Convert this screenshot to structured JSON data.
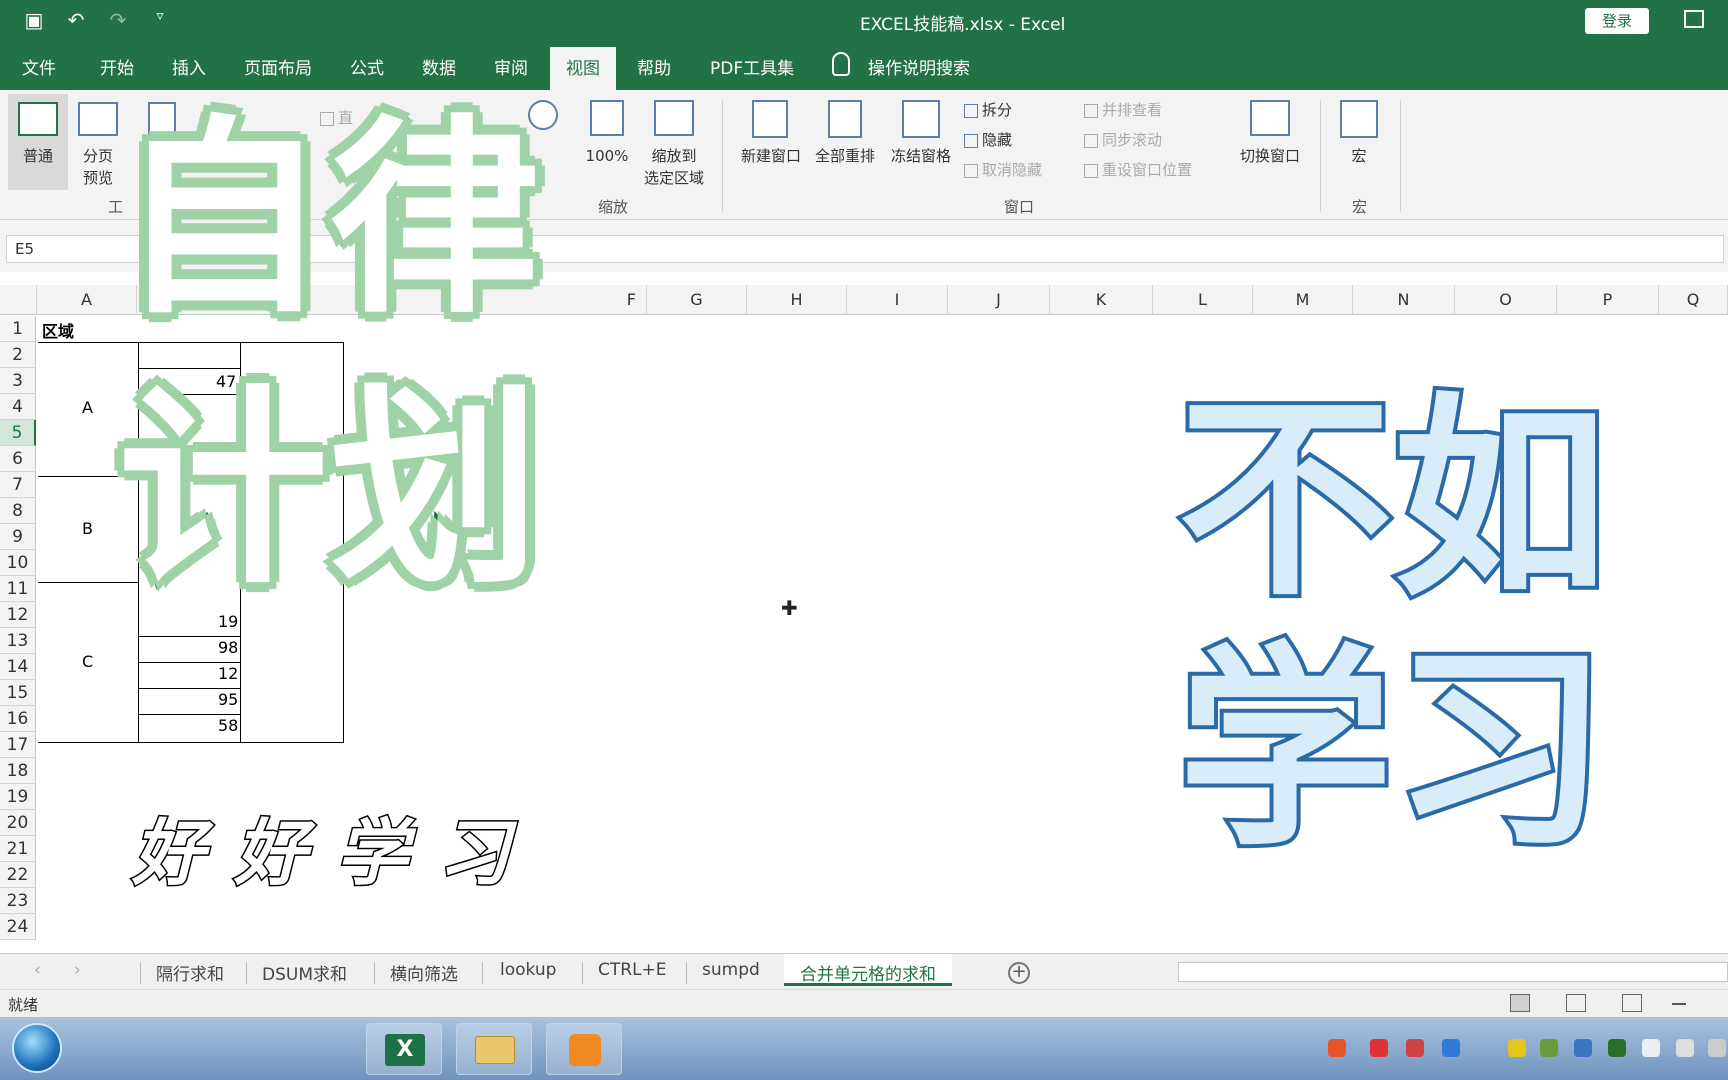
{
  "window": {
    "title": "EXCEL技能稿.xlsx  -  Excel",
    "login_label": "登录"
  },
  "menu": {
    "tabs": [
      "文件",
      "开始",
      "插入",
      "页面布局",
      "公式",
      "数据",
      "审阅",
      "视图",
      "帮助",
      "PDF工具集"
    ],
    "active_tab": "视图",
    "search_label": "操作说明搜索"
  },
  "ribbon": {
    "normal": "普通",
    "page_break_1": "分页",
    "page_break_2": "预览",
    "group1_partial": "工",
    "checkbox_partial": "直",
    "zoom_100": "100%",
    "zoom_selection_1": "缩放到",
    "zoom_selection_2": "选定区域",
    "zoom_group": "缩放",
    "new_window": "新建窗口",
    "arrange_all": "全部重排",
    "freeze_panes": "冻结窗格",
    "split": "拆分",
    "hide": "隐藏",
    "unhide": "取消隐藏",
    "side_by_side": "并排查看",
    "sync_scroll": "同步滚动",
    "reset_position": "重设窗口位置",
    "switch_window": "切换窗口",
    "window_group": "窗口",
    "macros": "宏",
    "macro_group": "宏"
  },
  "formula_bar": {
    "name_box": "E5",
    "formula": ""
  },
  "columns": [
    "A",
    "F",
    "G",
    "H",
    "I",
    "J",
    "K",
    "L",
    "M",
    "N",
    "O",
    "P",
    "Q"
  ],
  "rows": [
    "1",
    "2",
    "3",
    "4",
    "5",
    "6",
    "7",
    "8",
    "9",
    "10",
    "11",
    "12",
    "13",
    "14",
    "15",
    "16",
    "17",
    "18",
    "19",
    "20",
    "21",
    "22",
    "23",
    "24"
  ],
  "selected_row": "5",
  "cells": {
    "a1": "区域",
    "region_a": "A",
    "region_b": "B",
    "region_c": "C",
    "b3": "47",
    "b12": "19",
    "b13": "98",
    "b14": "12",
    "b15": "95",
    "b16": "58"
  },
  "sheet_tabs": [
    "隔行求和",
    "DSUM求和",
    "横向筛选",
    "lookup",
    "CTRL+E",
    "sumpd",
    "合并单元格的求和"
  ],
  "active_sheet": "合并单元格的求和",
  "status": "就绪",
  "overlay": {
    "line1": "自律",
    "line2": "计划",
    "line3": "不如",
    "line4": "学习",
    "caption": "好好学习"
  },
  "colors": {
    "excel_green": "#217346",
    "overlay_green_stroke": "#1f6b35",
    "overlay_blue_stroke": "#2a6aa8"
  }
}
